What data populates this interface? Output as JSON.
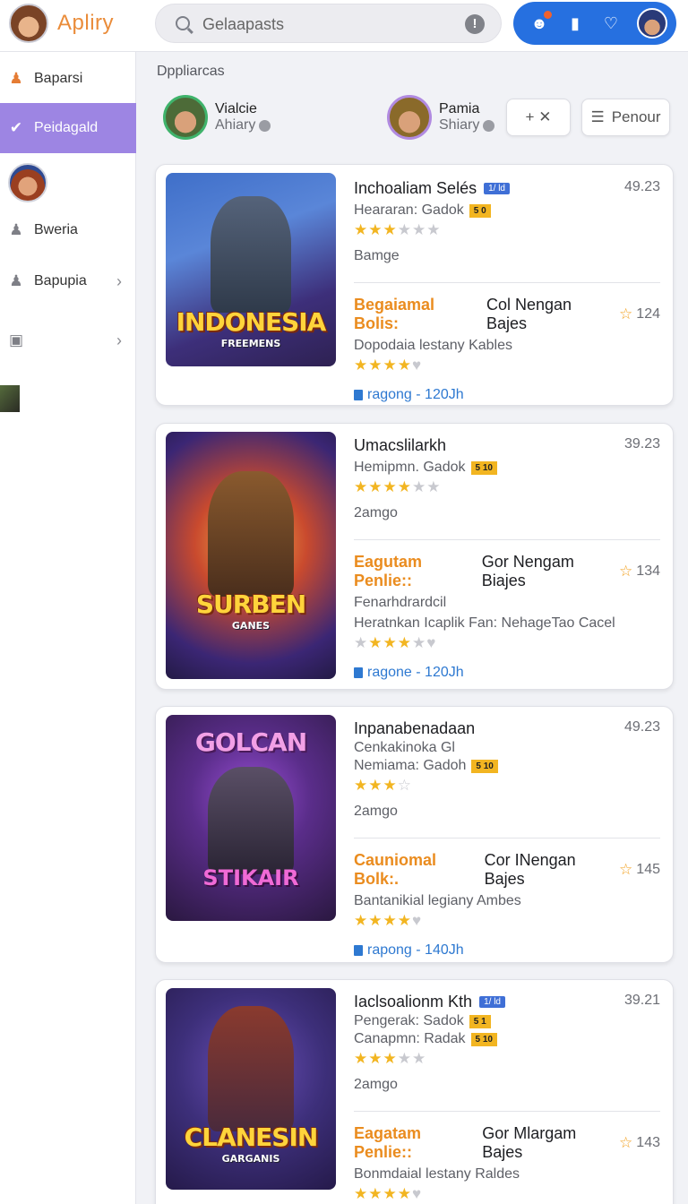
{
  "app": {
    "title": "Apliry"
  },
  "search": {
    "placeholder": "Gelaapasts"
  },
  "sidebar": {
    "items": [
      {
        "label": "Baparsi"
      },
      {
        "label": "Peidagald"
      },
      {
        "label": "Bweria"
      },
      {
        "label": "Bapupia"
      }
    ]
  },
  "section": {
    "title": "Dppliarcas",
    "creators": [
      {
        "name": "Vialcie",
        "sub": "Ahiary"
      },
      {
        "name": "Pamia",
        "sub": "Shiary"
      }
    ],
    "add_button": "+ ✕",
    "menu_button": "Penour"
  },
  "colors": {
    "accent": "#2670e0",
    "brand": "#ea8c3a",
    "active_nav": "#9d85e3",
    "star": "#f2b521"
  },
  "cards": [
    {
      "title": "Inchoaliam Selés",
      "tag": "1/ ld",
      "score": "49.23",
      "line1_label": "Heararan: Gadok",
      "line1_tag": "5 0",
      "stars": 3,
      "genre": "Bamge",
      "headline_hl": "Begaiamal Bolis:",
      "headline_rest": "Col Nengan Bajes",
      "headline_num": "124",
      "desc": "Dopodaia lestany Kables",
      "stars2": 4,
      "link": "ragong - 120Jh",
      "art_title": "INDONESIA",
      "art_sub": "FREEMENS"
    },
    {
      "title": "Umacslilarkh",
      "score": "39.23",
      "line1_label": "Hemipmn. Gadok",
      "line1_tag": "5 10",
      "stars": 4,
      "genre": "2amgo",
      "headline_hl": "Eagutam Penlie::",
      "headline_rest": "Gor Nengam Biajes",
      "headline_num": "134",
      "desc": "Fenarhdrardcil",
      "desc2": "Heratnkan Icaplik Fan: NehageTao Cacel",
      "stars2": 3,
      "link": "ragone - 120Jh",
      "art_title": "SURBEN",
      "art_sub": "GANES"
    },
    {
      "title": "Inpanabenadaan",
      "score": "49.23",
      "sub_line": "Cenkakinoka Gl",
      "line1_label": "Nemiama: Gadoh",
      "line1_tag": "5 10",
      "stars": 3,
      "genre": "2amgo",
      "headline_hl": "Cauniomal Bolk:.",
      "headline_rest": "Cor INengan Bajes",
      "headline_num": "145",
      "desc": "Bantanikial legiany Ambes",
      "stars2": 4,
      "link": "rapong - 140Jh",
      "art_title": "GOLCAN",
      "art_sub": "STIKAIR"
    },
    {
      "title": "Iaclsoalionm Kth",
      "tag": "1/ ld",
      "score": "39.21",
      "line1_label": "Pengerak: Sadok",
      "line1_tag": "5 1",
      "line2_label": "Canapmn: Radak",
      "line2_tag": "5 10",
      "stars": 3,
      "genre": "2amgo",
      "headline_hl": "Eagatam Penlie::",
      "headline_rest": "Gor Mlargam Bajes",
      "headline_num": "143",
      "desc": "Bonmdaial lestany Raldes",
      "stars2": 4,
      "art_title": "CLANESIN",
      "art_sub": "GARGANIS"
    }
  ]
}
